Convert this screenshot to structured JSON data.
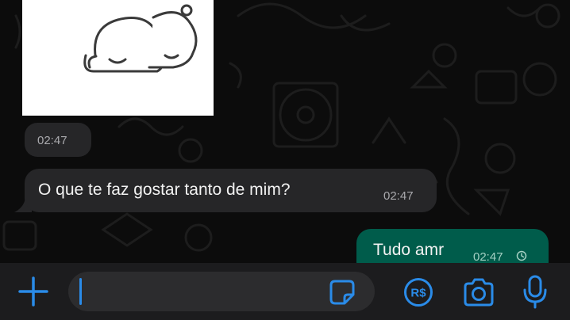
{
  "chat": {
    "sticker_timestamp": "02:47",
    "incoming_message": {
      "text": "O que te faz gostar tanto de mim?",
      "time": "02:47"
    },
    "outgoing_message": {
      "text": "Tudo amr",
      "time": "02:47",
      "status_icon": "clock-icon"
    }
  },
  "composer": {
    "input_value": "",
    "icons": [
      "plus-icon",
      "sticker-icon",
      "payment-icon",
      "camera-icon",
      "microphone-icon"
    ],
    "payment_icon_text": "R$"
  },
  "colors": {
    "accent": "#2a8be8",
    "incoming_bubble": "#262628",
    "outgoing_bubble": "#005c4b",
    "background": "#0c0c0c"
  }
}
